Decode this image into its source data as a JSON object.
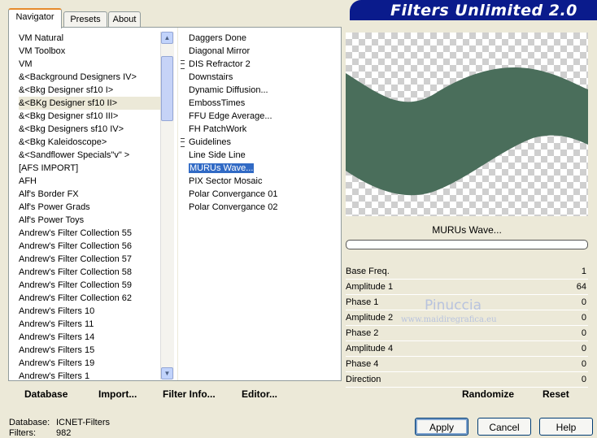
{
  "tabs": [
    "Navigator",
    "Presets",
    "About"
  ],
  "categories": [
    "VM Natural",
    "VM Toolbox",
    "VM",
    "&<Background Designers IV>",
    "&<Bkg Designer sf10 I>",
    "&<BKg Designer sf10 II>",
    "&<Bkg Designer sf10 III>",
    "&<Bkg Designers sf10 IV>",
    "&<Bkg Kaleidoscope>",
    "&<Sandflower Specials\"v\" >",
    "[AFS IMPORT]",
    "AFH",
    "Alf's Border FX",
    "Alf's Power Grads",
    "Alf's Power Toys",
    "Andrew's Filter Collection 55",
    "Andrew's Filter Collection 56",
    "Andrew's Filter Collection 57",
    "Andrew's Filter Collection 58",
    "Andrew's Filter Collection 59",
    "Andrew's Filter Collection 62",
    "Andrew's Filters 10",
    "Andrew's Filters 11",
    "Andrew's Filters 14",
    "Andrew's Filters 15",
    "Andrew's Filters 19",
    "Andrew's Filters 1"
  ],
  "selected_category": "&<BKg Designer sf10 II>",
  "filters": [
    {
      "name": "Daggers Done",
      "group": false
    },
    {
      "name": "Diagonal Mirror",
      "group": false
    },
    {
      "name": "DIS Refractor 2",
      "group": true
    },
    {
      "name": "Downstairs",
      "group": false
    },
    {
      "name": "Dynamic Diffusion...",
      "group": false
    },
    {
      "name": "EmbossTimes",
      "group": false
    },
    {
      "name": "FFU Edge Average...",
      "group": false
    },
    {
      "name": "FH PatchWork",
      "group": false
    },
    {
      "name": "Guidelines",
      "group": true
    },
    {
      "name": "Line Side Line",
      "group": false
    },
    {
      "name": "MURUs Wave...",
      "group": false
    },
    {
      "name": "PIX Sector Mosaic",
      "group": false
    },
    {
      "name": "Polar Convergance 01",
      "group": false
    },
    {
      "name": "Polar Convergance 02",
      "group": false
    }
  ],
  "selected_filter": "MURUs Wave...",
  "bottom_buttons": {
    "database": "Database",
    "import": "Import...",
    "filter_info": "Filter Info...",
    "editor": "Editor..."
  },
  "banner_title": "Filters Unlimited 2.0",
  "preview_color": "#4a6e5b",
  "current_filter_name": "MURUs Wave...",
  "params": [
    {
      "label": "Base Freq.",
      "value": "1"
    },
    {
      "label": "Amplitude 1",
      "value": "64"
    },
    {
      "label": "Phase 1",
      "value": "0"
    },
    {
      "label": "Amplitude 2",
      "value": "0"
    },
    {
      "label": "Phase 2",
      "value": "0"
    },
    {
      "label": "Amplitude 4",
      "value": "0"
    },
    {
      "label": "Phase 4",
      "value": "0"
    },
    {
      "label": "Direction",
      "value": "0"
    }
  ],
  "randomize": "Randomize",
  "reset": "Reset",
  "status": {
    "db_label": "Database:",
    "db_value": "ICNET-Filters",
    "filters_label": "Filters:",
    "filters_value": "982"
  },
  "actions": {
    "apply": "Apply",
    "cancel": "Cancel",
    "help": "Help"
  },
  "watermark": {
    "name": "Pinuccia",
    "site": "www.maidiregrafica.eu"
  }
}
